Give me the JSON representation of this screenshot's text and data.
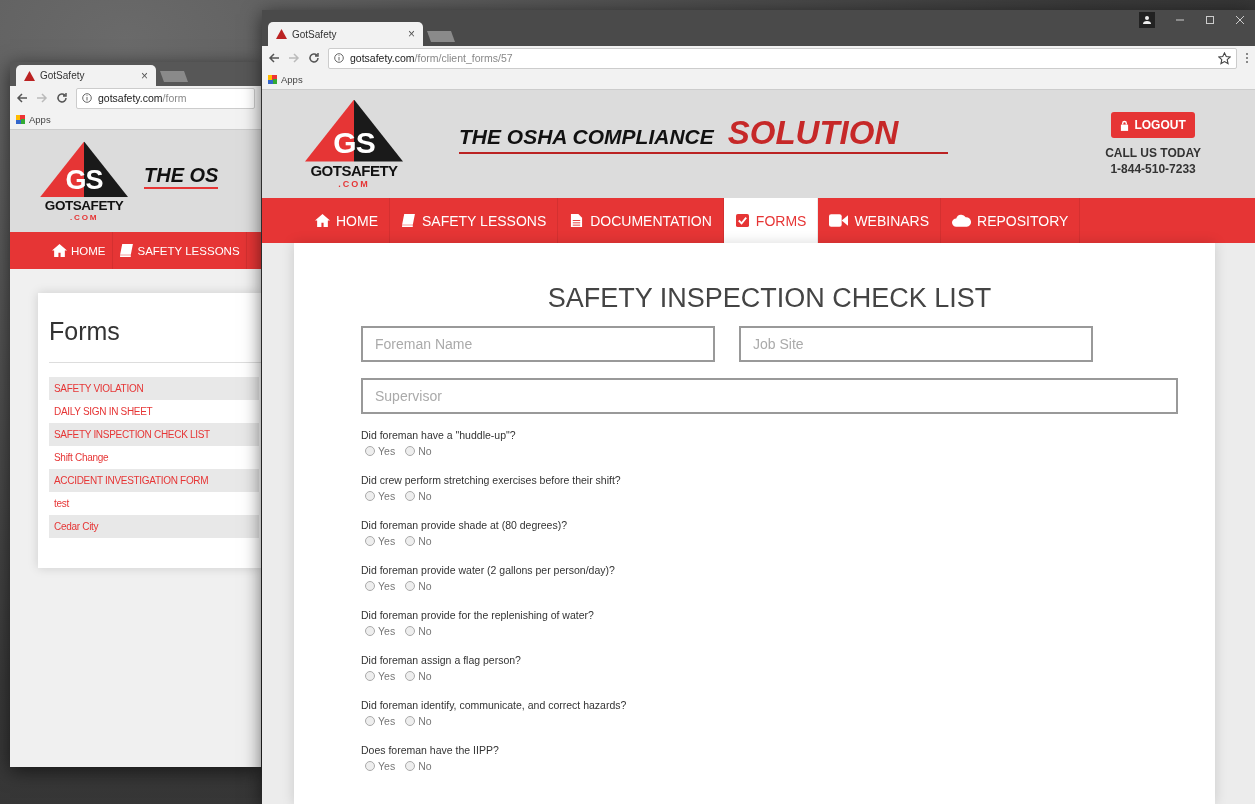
{
  "back_window": {
    "tab": {
      "title": "GotSafety",
      "close": "×"
    },
    "address": {
      "host": "gotsafety.com",
      "path": "/form"
    },
    "bookmarks": [
      "Apps"
    ],
    "logo": {
      "mark": "GS",
      "name": "GOTSAFETY",
      "domain": ".COM"
    },
    "tagline": "THE OS",
    "nav": [
      {
        "label": "HOME",
        "kind": "home",
        "selected": false
      },
      {
        "label": "SAFETY LESSONS",
        "kind": "book",
        "selected": false
      }
    ],
    "heading": "Forms",
    "forms": [
      "SAFETY VIOLATION",
      "DAILY SIGN IN SHEET",
      "SAFETY INSPECTION CHECK LIST",
      "Shift Change",
      "ACCIDENT INVESTIGATION FORM",
      "test",
      "Cedar City"
    ]
  },
  "front_window": {
    "tab": {
      "title": "GotSafety",
      "close": "×"
    },
    "address": {
      "host": "gotsafety.com",
      "path": "/form/client_forms/57"
    },
    "bookmarks": [
      "Apps"
    ],
    "logo": {
      "mark": "GS",
      "name": "GOTSAFETY",
      "domain": ".COM"
    },
    "tagline": {
      "lead": "THE OSHA COMPLIANCE",
      "emphasis": "SOLUTION"
    },
    "logout": "LOGOUT",
    "call": {
      "label": "CALL US TODAY",
      "phone": "1-844-510-7233"
    },
    "nav": [
      {
        "label": "HOME",
        "kind": "home",
        "selected": false
      },
      {
        "label": "SAFETY LESSONS",
        "kind": "book",
        "selected": false
      },
      {
        "label": "DOCUMENTATION",
        "kind": "document",
        "selected": false
      },
      {
        "label": "FORMS",
        "kind": "check",
        "selected": true
      },
      {
        "label": "WEBINARS",
        "kind": "video",
        "selected": false
      },
      {
        "label": "REPOSITORY",
        "kind": "cloud",
        "selected": false
      }
    ],
    "form": {
      "title": "SAFETY INSPECTION CHECK LIST",
      "fields": [
        {
          "placeholder": "Foreman Name"
        },
        {
          "placeholder": "Job Site"
        },
        {
          "placeholder": "Supervisor"
        }
      ],
      "questions": [
        {
          "text": "Did foreman have a \"huddle-up\"?",
          "options": [
            {
              "label": "Yes",
              "selected": false
            },
            {
              "label": "No",
              "selected": false
            }
          ]
        },
        {
          "text": "Did crew perform stretching exercises before their shift?",
          "options": [
            {
              "label": "Yes",
              "selected": false
            },
            {
              "label": "No",
              "selected": false
            }
          ]
        },
        {
          "text": "Did foreman provide shade at (80 degrees)?",
          "options": [
            {
              "label": "Yes",
              "selected": false
            },
            {
              "label": "No",
              "selected": false
            }
          ]
        },
        {
          "text": "Did foreman provide water (2 gallons per person/day)?",
          "options": [
            {
              "label": "Yes",
              "selected": false
            },
            {
              "label": "No",
              "selected": false
            }
          ]
        },
        {
          "text": "Did foreman provide for the replenishing of water?",
          "options": [
            {
              "label": "Yes",
              "selected": false
            },
            {
              "label": "No",
              "selected": false
            }
          ]
        },
        {
          "text": "Did foreman assign a flag person?",
          "options": [
            {
              "label": "Yes",
              "selected": false
            },
            {
              "label": "No",
              "selected": false
            }
          ]
        },
        {
          "text": "Did foreman identify, communicate, and correct hazards?",
          "options": [
            {
              "label": "Yes",
              "selected": false
            },
            {
              "label": "No",
              "selected": false
            }
          ]
        },
        {
          "text": "Does foreman have the IIPP?",
          "options": [
            {
              "label": "Yes",
              "selected": false
            },
            {
              "label": "No",
              "selected": false
            }
          ]
        }
      ]
    }
  }
}
